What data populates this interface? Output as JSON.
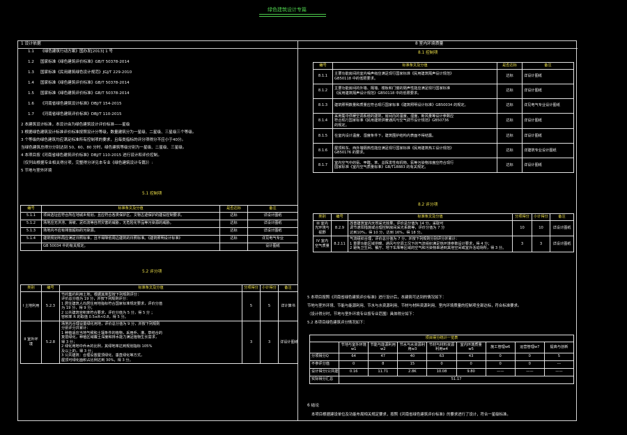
{
  "title": "绿色建筑设计专篇",
  "left": {
    "design_basis_heading": "1  设计依据",
    "basis_items": [
      {
        "no": "1.1",
        "text": "《绿色建筑行动方案》国办发[2013]  1 号"
      },
      {
        "no": "1.2",
        "text": "国家标准《绿色建筑评价标准》GB/T   50378-2014"
      },
      {
        "no": "1.3",
        "text": "国家标准《民用建筑绿色设计规范》JGJ/T   229-2010"
      },
      {
        "no": "1.4",
        "text": "国家标准《绿色建筑评价标准》GB/T   50378-2014"
      },
      {
        "no": "1.5",
        "text": "国家标准《绿色建筑评价标准》GB/T   50378-2014"
      },
      {
        "no": "1.6",
        "text": "《河南省绿色建筑设计标准》DBJ/T   154-2015"
      },
      {
        "no": "1.7",
        "text": "《河南省绿色建筑评价标准》DBJ/T   110-2015"
      }
    ],
    "notes": [
      "2  本建筑设计标准，本设计由为绿色建筑设计评价标准——星级",
      "3  根据绿色建筑设计标准评价标准按照设计分等级，数量建筑分为一星级、二星级、三星级三个等级。",
      "    3 个等级的绿色建筑均应满足标准所有控制项的要求，且每类指标的评分项得分不应小于40分。",
      "    当绿色建筑总得分分别达到 50、60、80 分时，绿色建筑等级分别为一星级、二星级、三星级。",
      "4  本项目按《河南省绿色建筑评价标准》DBJ/T     110-2015      进行设计和评价控制。",
      "   （仅列出根据专业相关得分项，完整得分详见本专业《绿色建筑设计专篇》）:",
      "5  节地与室外环境"
    ],
    "sec51_title": "5.1    控制项",
    "table51": {
      "headers": [
        "编号",
        "标准条文及分值",
        "是否达标",
        "备注"
      ],
      "rows": [
        [
          "5.1.1",
          "项目选址应符合所在地城乡规划，且应符合各类保护区、文物古迹保护的建设控制要求。",
          "达标",
          "详设计图纸"
        ],
        [
          "5.1.2",
          "场地应无洪涝、滑坡、泥石流等自然灾害的威胁，无危险化学品等污染源的威胁。",
          "达标",
          "详设计图纸"
        ],
        [
          "5.1.3",
          "场地内不应有排放超标的污染源。",
          "达标",
          "详设计图纸"
        ],
        [
          "5.1.4",
          "建筑规划布局应满足日照标准，且不得降低周边建筑的日照标准。《建筑照明设计标准》",
          "达标",
          "详见电气专业"
        ],
        [
          "",
          "GB 50034    中的有关规定。",
          "",
          "设计图纸"
        ]
      ]
    },
    "sec52_title": "5.2    评分项",
    "table52": {
      "headers": [
        "类别",
        "编号",
        "标准条文及分值",
        "分项得分",
        "小计得分",
        "备注"
      ],
      "rows": [
        {
          "cat": "I  土地利用",
          "no": "5.2.3",
          "lines": [
            "节约集约利用土地，根据其类型按下列规则评分：",
            "评价总分值为 19 分，并按下列规则评分：",
            "1  居住建筑人均居住用地指标符合国家标准规定要求，评价分值",
            "   为 19 分，得 9 分；",
            "2  公共建筑容积率符合要求，评价分值为 5 分，得 5 分 ；",
            "   容积率 R 的取值 0.5≤R<0.8，得 5 分。"
          ],
          "score": "5",
          "sub": "5",
          "note": "详计算书"
        },
        {
          "cat": "II  室外环境",
          "no": "5.2.8",
          "lines": [
            "场地内合理设置绿化用地，评价总分值为 9 分，并按下列规则",
            "分别评分并累计：",
            "1  种植适应当地气候和土壤条件的植物，采用乔、灌、草结合的",
            "   复层绿化，种植区域覆土深度和排水能力满足植物生长需求，",
            "   得 3 分；",
            "2  绿化用地中乔木的比例，其绿地率达到规划指标 105%",
            "   及以上的，得 3 分；",
            "3  公共建筑：合理设置屋顶绿化、垂直绿化等方式，",
            "   屋顶可绿化面积占比例达到 30%，得 3 分。"
          ],
          "score": "3",
          "sub": "3",
          "note": "详设计图纸"
        }
      ]
    }
  },
  "right": {
    "sec8_title": "8  室内环境质量",
    "sec81_title": "8.1    控制项",
    "table81": {
      "headers": [
        "编号",
        "标准条文及分值",
        "是否达标",
        "备注"
      ],
      "rows": [
        {
          "no": "8.1.1",
          "lines": [
            "主要功能房间的室内噪声级应满足现行国家标准《民用建筑隔声设计规范》",
            "GB50118    中的低限要求。"
          ],
          "ok": "达标",
          "note": "详设计图纸"
        },
        {
          "no": "8.1.2",
          "lines": [
            "主要功能房间的外墙、隔墙、楼板和门窗的隔声性能应满足现行国家标准",
            "《民用建筑隔声设计规范》GB50118    中的低限要求。"
          ],
          "ok": "达标",
          "note": "详设计图纸"
        },
        {
          "no": "8.1.3",
          "lines": [
            "建筑照明数量和质量应符合现行国家标准《建筑照明设计标准》GB50034    的规定。"
          ],
          "ok": "达标",
          "note": "详见电气专业设计图纸"
        },
        {
          "no": "8.1.4",
          "lines": [
            "采用集中供暖空调系统的建筑，房间内的温度、湿度、新风量等设计参数应",
            "符合现行国家标准《民用建筑供暖通风与空气调节设计规范》GB50736",
            "的规定。"
          ],
          "ok": "达标",
          "note": "详设计图纸"
        },
        {
          "no": "8.1.5",
          "lines": [
            "在室内设计温度、湿度条件下，建筑围护结构内表面不得结露。"
          ],
          "ok": "达标",
          "note": "详设计图纸"
        },
        {
          "no": "8.1.6",
          "lines": [
            "屋顶和东、西外墙隔热性能应满足现行国家标准《民用建筑热工设计规范》",
            "GB50176    的要求。"
          ],
          "ok": "达标",
          "note": "详建筑专业设计图纸"
        },
        {
          "no": "8.1.7",
          "lines": [
            "室内空气中的氨、甲醛、苯、总挥发性有机物、氡等污染物浓度应符合现行",
            "国家标准《室内空气质量标准》GB/T18883       的有关规定。"
          ],
          "ok": "达标",
          "note": "详设计图纸"
        }
      ]
    },
    "sec82_title": "8.2    评分项",
    "table82": {
      "headers": [
        "类别",
        "编号",
        "标准条文及分值",
        "分项得分",
        "小计得分",
        "备注"
      ],
      "rows": [
        {
          "cat": "III  室内光环境与视野",
          "no": "8.2.9",
          "lines": [
            "改善建筑室内天然采光效果，评价总分值为 14 分，采取可",
            "调节遮阳措施或合理控制房间采光系数等，评价分值为 7 分",
            "达到10%，得 10 分，达到 16%，得 18 分。"
          ],
          "score": "10",
          "sub": "10",
          "note": "详设计图纸"
        },
        {
          "cat": "IV  室内空气质量",
          "no": "8.2.11",
          "lines": [
            "气流组织合理，评价总分值为 7 分，并按下列规则分别评分并累计：",
            "1  重要功能区域供暖、通风与空调工况下的气流组织满足热环境参数设计要求，得 4 分；",
            "2  避免卫生间、餐厅、地下车库等区域的空气和污染物串通到其他空间或室外活动场所，得 3 分。"
          ],
          "score": "3",
          "sub": "3",
          "note": "详设计图纸"
        }
      ]
    },
    "summary": [
      "5   本项目按照《河南省绿色建筑评价标准》进行设计后，本建筑可达到的情况如下：",
      "     节地与室外环境、节能与能源利用、节水与水资源利用、节材与材料资源利用、室内环境质量的控制项全部达标，符合标准要求。",
      "     （设计得分时，节地与室外环境专业按专业范围）具体得分如下：",
      "5.2   本项目绿色建筑评分情况如下："
    ],
    "score_table": {
      "caption": "项目得分统计一览表",
      "headers": [
        "",
        "节地与室外环境w1",
        "节能与能源利用w2",
        "节水与水资源利用w3",
        "节材与材料资源利用w4",
        "室内环境质量w5",
        "施工管理w6",
        "运营管理w7",
        "提高与创新"
      ],
      "rows": [
        [
          "分项得分Q",
          "64",
          "47",
          "40",
          "63",
          "43",
          "0",
          "0",
          "5"
        ],
        [
          "不参评分值",
          "0",
          "8",
          "15",
          "0",
          "0",
          "0",
          "0",
          "---"
        ],
        [
          "设计得分(公共建筑)",
          "0.16",
          "11.71",
          "2.8K",
          "10.08",
          "9.80",
          "——",
          "——",
          "——"
        ],
        [
          "实际得分汇总",
          "",
          "",
          "",
          "51.17",
          "",
          "",
          "",
          ""
        ]
      ]
    },
    "conclusion_heading": "6  结论",
    "conclusion": "本项目根据建设单位及功能布局相关规定要求，按照《河南省绿色建筑评价标准》的要求进行了设计，符合一星级标准。"
  }
}
